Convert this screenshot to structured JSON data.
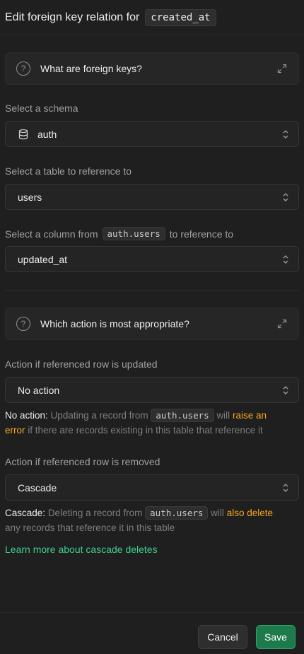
{
  "header": {
    "title": "Edit foreign key relation for",
    "column": "created_at"
  },
  "info_foreign_keys": {
    "label": "What are foreign keys?",
    "icon": "question-circle-icon",
    "expand_icon": "expand-icon"
  },
  "schema": {
    "label": "Select a schema",
    "value": "auth",
    "icon": "database-icon"
  },
  "table": {
    "label": "Select a table to reference to",
    "value": "users"
  },
  "column": {
    "label_prefix": "Select a column from",
    "label_code": "auth.users",
    "label_suffix": "to reference to",
    "value": "updated_at"
  },
  "info_action": {
    "label": "Which action is most appropriate?"
  },
  "on_update": {
    "label": "Action if referenced row is updated",
    "value": "No action",
    "help_strong": "No action:",
    "help_1": "Updating a record from",
    "help_code": "auth.users",
    "help_2": "will",
    "help_warn_1": "raise an",
    "help_warn_2": "error",
    "help_3": "if there are records existing in this table that reference it"
  },
  "on_delete": {
    "label": "Action if referenced row is removed",
    "value": "Cascade",
    "help_strong": "Cascade:",
    "help_1": "Deleting a record from",
    "help_code": "auth.users",
    "help_2": "will",
    "help_warn": "also delete",
    "help_3": "any records that reference it in this table"
  },
  "learn_more": "Learn more about cascade deletes",
  "footer": {
    "cancel": "Cancel",
    "save": "Save"
  },
  "colors": {
    "background": "#1f1f1f",
    "accent_green": "#3ecf8e",
    "save_button": "#1c7a4b",
    "warning": "#f5a623"
  }
}
